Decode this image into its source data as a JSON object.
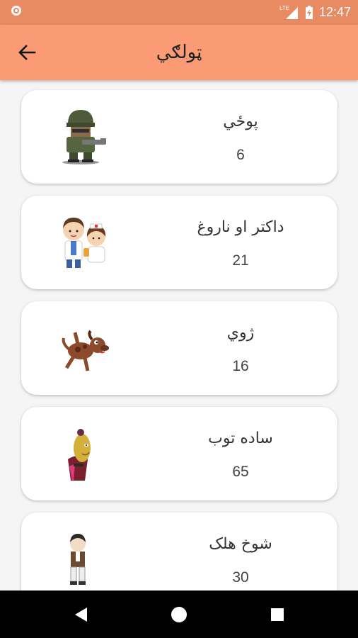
{
  "status_bar": {
    "time": "12:47",
    "network": "LTE"
  },
  "app_bar": {
    "title": "ټولګي"
  },
  "items": [
    {
      "title": "پوځي",
      "count": "6",
      "icon": "soldier-icon"
    },
    {
      "title": "داکتر او ناروغ",
      "count": "21",
      "icon": "doctor-nurse-icon"
    },
    {
      "title": "ژوي",
      "count": "16",
      "icon": "dog-icon"
    },
    {
      "title": "ساده توب",
      "count": "65",
      "icon": "simple-character-icon"
    },
    {
      "title": "شوخ هلک",
      "count": "30",
      "icon": "boy-icon"
    }
  ],
  "colors": {
    "status_bar": "#e88a62",
    "app_bar": "#fb9b76",
    "background": "#f5f5f5"
  }
}
